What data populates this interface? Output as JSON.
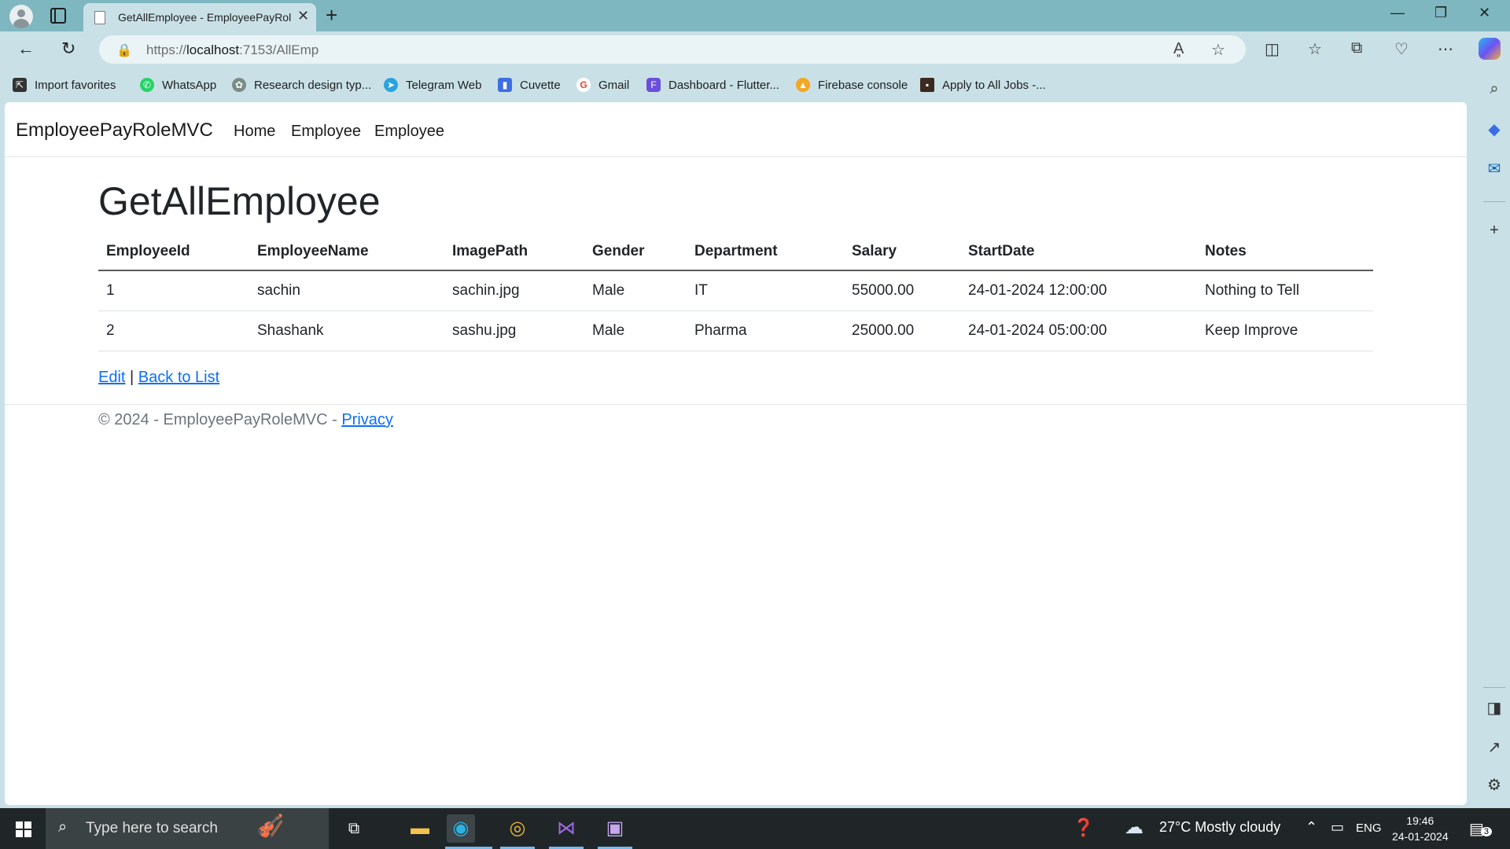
{
  "browser": {
    "tab_title": "GetAllEmployee - EmployeePayRoleMVC",
    "url_scheme": "https://",
    "url_host": "localhost",
    "url_rest": ":7153/AllEmp",
    "favorites": [
      {
        "label": "Import favorites",
        "icon": "import-favorites-icon",
        "color": "#333333"
      },
      {
        "label": "WhatsApp",
        "icon": "whatsapp-icon",
        "color": "#25d366"
      },
      {
        "label": "Research design typ...",
        "icon": "chatgpt-icon",
        "color": "#7a8c86"
      },
      {
        "label": "Telegram Web",
        "icon": "telegram-icon",
        "color": "#2aa3df"
      },
      {
        "label": "Cuvette",
        "icon": "cuvette-icon",
        "color": "#3d6fe0"
      },
      {
        "label": "Gmail",
        "icon": "google-icon",
        "color": "#ea4335"
      },
      {
        "label": "Dashboard - Flutter...",
        "icon": "flutterflow-icon",
        "color": "#6b4fdc"
      },
      {
        "label": "Firebase console",
        "icon": "firebase-icon",
        "color": "#f5a623"
      },
      {
        "label": "Apply to All Jobs -...",
        "icon": "jobs-site-icon",
        "color": "#3a2a20"
      }
    ]
  },
  "app": {
    "brand": "EmployeePayRoleMVC",
    "nav": [
      "Home",
      "Employee",
      "Employee"
    ],
    "page_title": "GetAllEmployee",
    "table": {
      "headers": [
        "EmployeeId",
        "EmployeeName",
        "ImagePath",
        "Gender",
        "Department",
        "Salary",
        "StartDate",
        "Notes"
      ],
      "rows": [
        [
          "1",
          "sachin",
          "sachin.jpg",
          "Male",
          "IT",
          "55000.00",
          "24-01-2024 12:00:00",
          "Nothing to Tell"
        ],
        [
          "2",
          "Shashank",
          "sashu.jpg",
          "Male",
          "Pharma",
          "25000.00",
          "24-01-2024 05:00:00",
          "Keep Improve"
        ]
      ]
    },
    "actions": {
      "edit": "Edit",
      "separator": "|",
      "back": "Back to List"
    },
    "footer": {
      "text": "© 2024 - EmployeePayRoleMVC - ",
      "privacy": "Privacy"
    }
  },
  "taskbar": {
    "search_placeholder": "Type here to search",
    "weather": "27°C  Mostly cloudy",
    "language": "ENG",
    "time": "19:46",
    "date": "24-01-2024",
    "notifications": "3"
  }
}
